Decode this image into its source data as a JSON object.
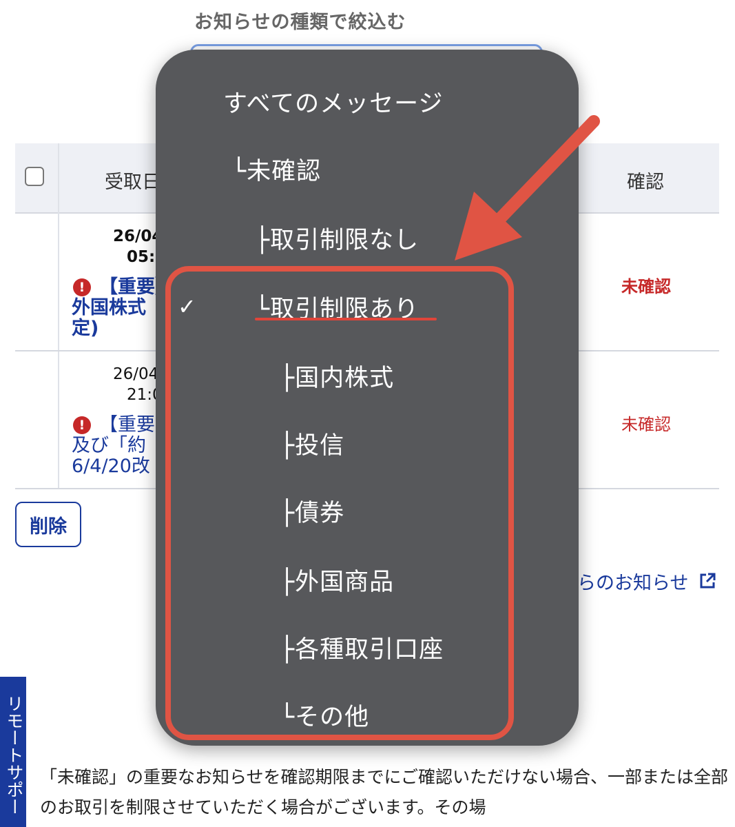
{
  "filter": {
    "label": "お知らせの種類で絞込む"
  },
  "table": {
    "header_date": "受取日",
    "header_confirm": "確認",
    "rows": [
      {
        "date_line1": "26/04",
        "time_line2": "05:0",
        "title": "【重要】外国株式定)",
        "status": "未確認"
      },
      {
        "date_line1": "26/04",
        "time_line2": "21:0",
        "title": "【重要及び「約6/4/20改",
        "status": "未確認"
      }
    ]
  },
  "delete_label": "削除",
  "other_notice": "らのお知らせ",
  "remote_tab": "リモートサポー",
  "note": "「未確認」の重要なお知らせを確認期限までにご確認いただけない場合、一部または全部のお取引を制限させていただく場合がございます。その場",
  "menu": {
    "items": [
      {
        "label": "すべてのメッセージ"
      },
      {
        "label": "└未確認"
      },
      {
        "label": "├取引制限なし"
      },
      {
        "label": "└取引制限あり",
        "selected": true
      },
      {
        "label": "├国内株式"
      },
      {
        "label": "├投信"
      },
      {
        "label": "├債券"
      },
      {
        "label": "├外国商品"
      },
      {
        "label": "├各種取引口座"
      },
      {
        "label": "└その他"
      }
    ],
    "check_mark": "✓"
  },
  "colors": {
    "accent": "#1a3a9c",
    "alert": "#c62828",
    "annotation": "#e05444",
    "menu_bg": "#57585b"
  },
  "icons": [
    "checkbox-icon",
    "alert-icon",
    "external-link-icon",
    "checkmark-icon",
    "arrow-annotation"
  ]
}
